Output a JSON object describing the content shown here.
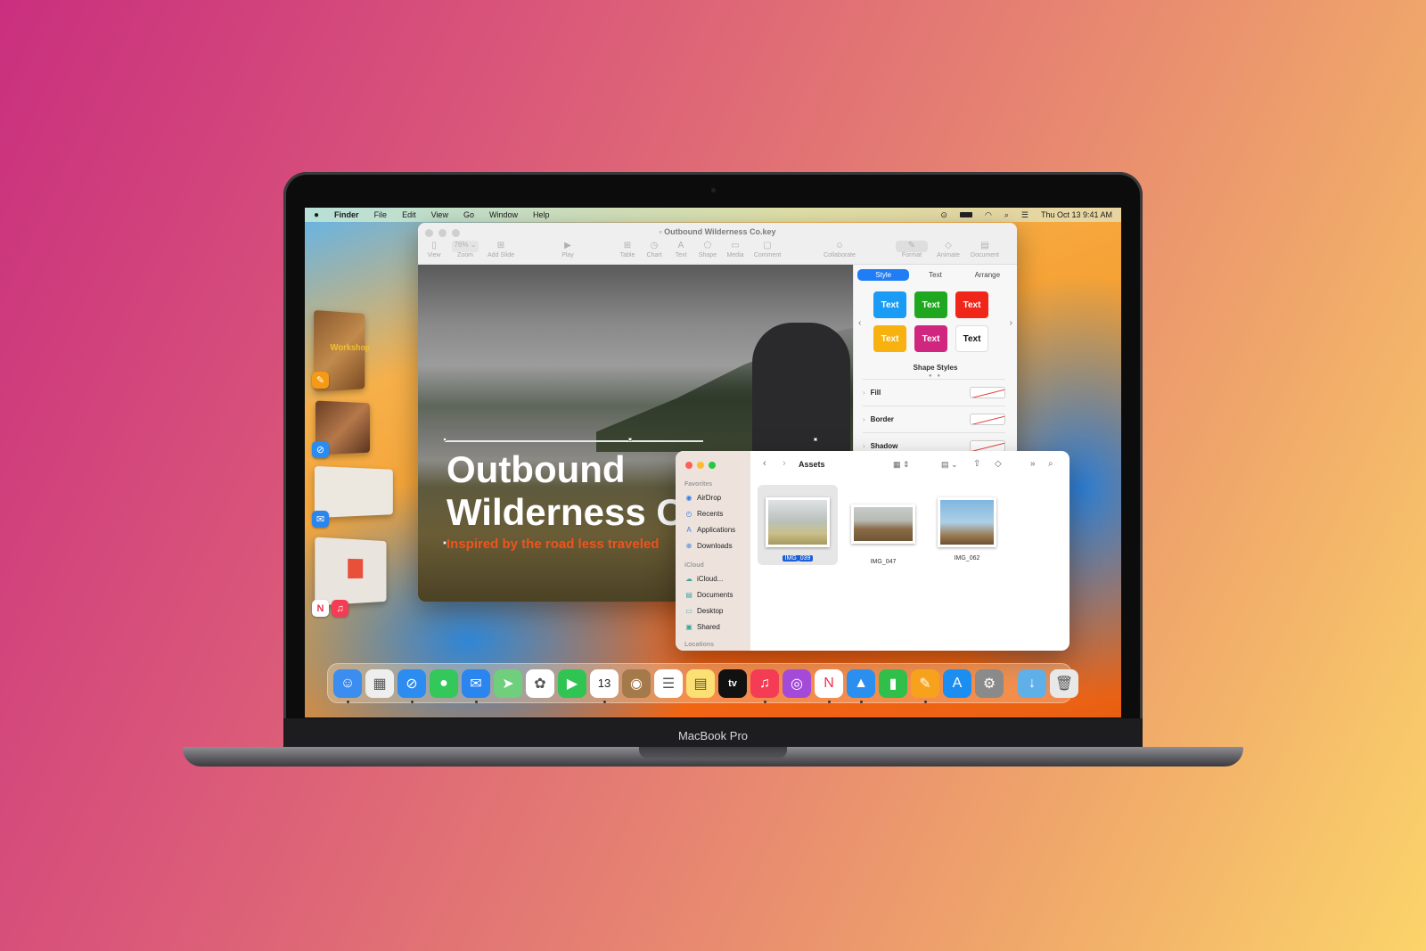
{
  "menubar": {
    "apple": "",
    "items": [
      "Finder",
      "File",
      "Edit",
      "View",
      "Go",
      "Window",
      "Help"
    ],
    "status_icons": [
      "play-circle-icon",
      "battery-icon",
      "wifi-icon",
      "search-icon",
      "control-center-icon"
    ],
    "clock": "Thu Oct 13  9:41 AM"
  },
  "keynote": {
    "title": "Outbound Wilderness Co.key",
    "toolbar": [
      {
        "label": "View",
        "icon": "▯"
      },
      {
        "label": "Zoom",
        "icon": "76% ⌄"
      },
      {
        "label": "Add Slide",
        "icon": "⊞"
      },
      {
        "label": "Play",
        "icon": "▶"
      },
      {
        "label": "Table",
        "icon": "⊞"
      },
      {
        "label": "Chart",
        "icon": "◷"
      },
      {
        "label": "Text",
        "icon": "A"
      },
      {
        "label": "Shape",
        "icon": "⬠"
      },
      {
        "label": "Media",
        "icon": "▭"
      },
      {
        "label": "Comment",
        "icon": "▢"
      },
      {
        "label": "Collaborate",
        "icon": "☺"
      },
      {
        "label": "Format",
        "icon": "✎"
      },
      {
        "label": "Animate",
        "icon": "◇"
      },
      {
        "label": "Document",
        "icon": "▤"
      }
    ],
    "zoom_value": "76%",
    "slide": {
      "title_line1": "Outbound",
      "title_line2": "Wilderness Co.",
      "subtitle": "Inspired by the road less traveled"
    },
    "panel": {
      "tabs": [
        "Style",
        "Text",
        "Arrange"
      ],
      "active_tab": "Style",
      "swatches": [
        {
          "label": "Text",
          "color": "#1a9bf5"
        },
        {
          "label": "Text",
          "color": "#1fa81f"
        },
        {
          "label": "Text",
          "color": "#f0261b"
        },
        {
          "label": "Text",
          "color": "#f7b210"
        },
        {
          "label": "Text",
          "color": "#d1267f"
        },
        {
          "label": "Text",
          "color": "#ffffff"
        }
      ],
      "section_label": "Shape Styles",
      "properties": [
        "Fill",
        "Border",
        "Shadow"
      ]
    }
  },
  "finder": {
    "title": "Assets",
    "sidebar": {
      "favorites_label": "Favorites",
      "favorites": [
        {
          "label": "AirDrop",
          "icon": "◉"
        },
        {
          "label": "Recents",
          "icon": "◴"
        },
        {
          "label": "Applications",
          "icon": "A"
        },
        {
          "label": "Downloads",
          "icon": "⊕"
        }
      ],
      "icloud_label": "iCloud",
      "icloud": [
        {
          "label": "iCloud...",
          "icon": "☁"
        },
        {
          "label": "Documents",
          "icon": "▤"
        },
        {
          "label": "Desktop",
          "icon": "▭"
        },
        {
          "label": "Shared",
          "icon": "▣"
        }
      ],
      "locations_label": "Locations"
    },
    "files": [
      {
        "name": "IMG_039",
        "selected": true
      },
      {
        "name": "IMG_047",
        "selected": false
      },
      {
        "name": "IMG_062",
        "selected": false
      }
    ]
  },
  "stage_manager": [
    "Pages",
    "Safari",
    "Mail",
    "News & Music"
  ],
  "dock": [
    {
      "name": "Finder",
      "icon": "☺",
      "color": "#3b8df0",
      "running": true
    },
    {
      "name": "Launchpad",
      "icon": "▦",
      "color": "#eeeeee",
      "running": false
    },
    {
      "name": "Safari",
      "icon": "⊘",
      "color": "#2c8cf0",
      "running": true
    },
    {
      "name": "Messages",
      "icon": "●",
      "color": "#34c759",
      "running": false
    },
    {
      "name": "Mail",
      "icon": "✉",
      "color": "#2a85ee",
      "running": true
    },
    {
      "name": "Maps",
      "icon": "➤",
      "color": "#6fcf7c",
      "running": false
    },
    {
      "name": "Photos",
      "icon": "✿",
      "color": "#ffffff",
      "running": false
    },
    {
      "name": "FaceTime",
      "icon": "▶",
      "color": "#30c452",
      "running": false
    },
    {
      "name": "Calendar",
      "icon": "13",
      "color": "#ffffff",
      "running": true
    },
    {
      "name": "Contacts",
      "icon": "◉",
      "color": "#a57a4a",
      "running": false
    },
    {
      "name": "Reminders",
      "icon": "☰",
      "color": "#ffffff",
      "running": false
    },
    {
      "name": "Notes",
      "icon": "▤",
      "color": "#fbe073",
      "running": false
    },
    {
      "name": "TV",
      "icon": "tv",
      "color": "#111111",
      "running": false
    },
    {
      "name": "Music",
      "icon": "♫",
      "color": "#f53c55",
      "running": true
    },
    {
      "name": "Podcasts",
      "icon": "◎",
      "color": "#a34ad9",
      "running": false
    },
    {
      "name": "News",
      "icon": "N",
      "color": "#ffffff",
      "running": true
    },
    {
      "name": "Keynote",
      "icon": "▲",
      "color": "#2b8ff0",
      "running": true
    },
    {
      "name": "Numbers",
      "icon": "▮",
      "color": "#2fbf4a",
      "running": false
    },
    {
      "name": "Pages",
      "icon": "✎",
      "color": "#f7a21c",
      "running": true
    },
    {
      "name": "App Store",
      "icon": "A",
      "color": "#1c8ef2",
      "running": false
    },
    {
      "name": "System Settings",
      "icon": "⚙",
      "color": "#8a8a8a",
      "running": false
    },
    {
      "name": "Downloads",
      "icon": "↓",
      "color": "#5fb0e8",
      "running": false
    },
    {
      "name": "Trash",
      "icon": "🗑",
      "color": "#e8e8e8",
      "running": false
    }
  ],
  "device_label": "MacBook Pro"
}
